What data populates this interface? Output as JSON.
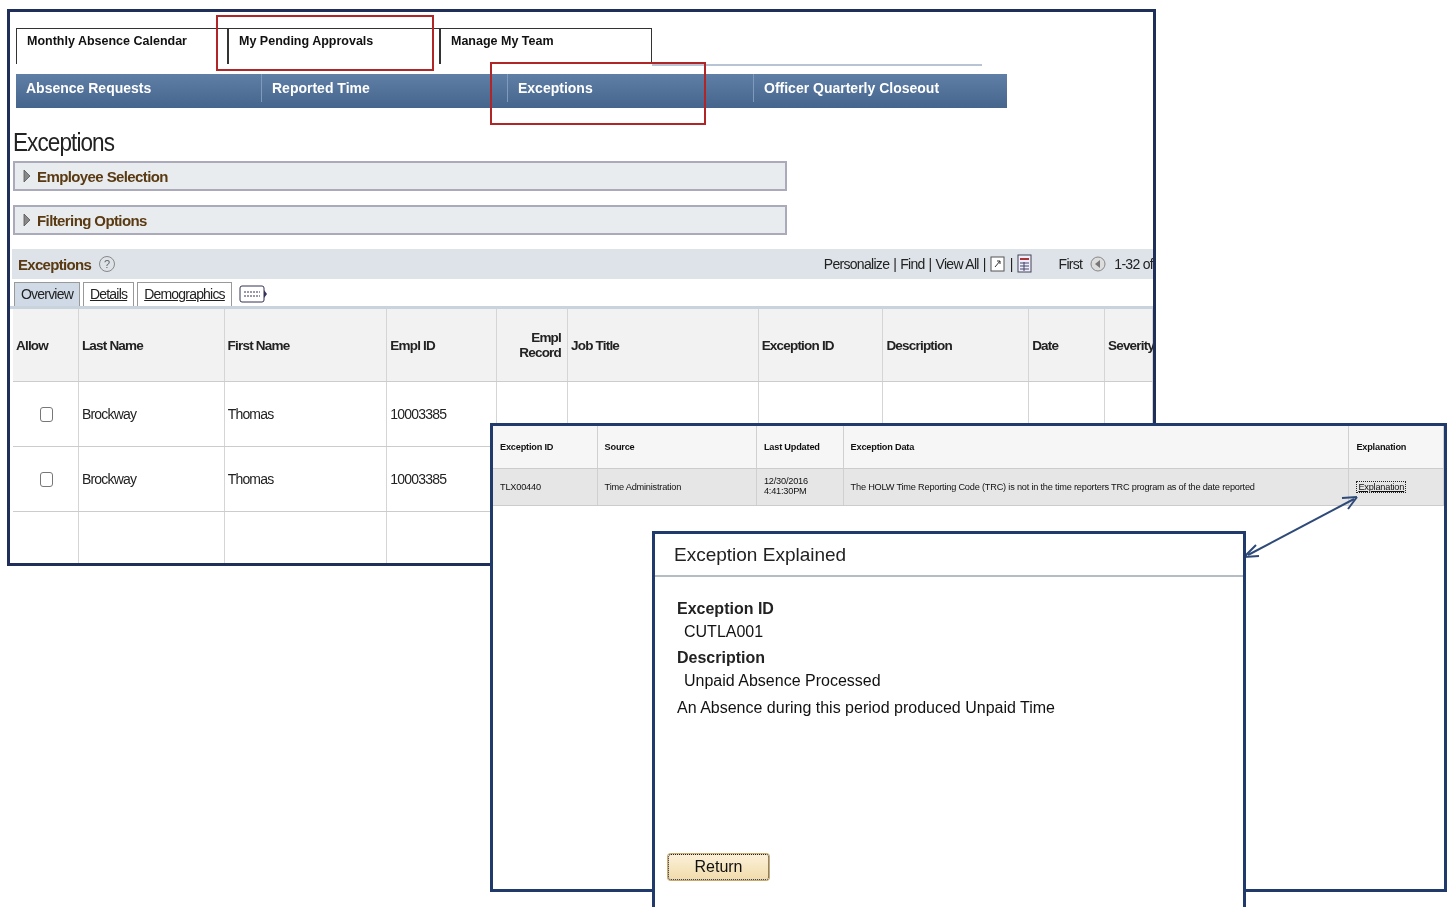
{
  "top_tabs": [
    {
      "label": "Monthly Absence Calendar",
      "highlighted": false
    },
    {
      "label": "My Pending Approvals",
      "highlighted": true
    },
    {
      "label": "Manage My Team",
      "highlighted": false
    }
  ],
  "nav_items": [
    {
      "label": "Absence Requests",
      "highlighted": false
    },
    {
      "label": "Reported Time",
      "highlighted": false
    },
    {
      "label": "Exceptions",
      "highlighted": true
    },
    {
      "label": "Officer Quarterly Closeout",
      "highlighted": false
    }
  ],
  "page_title": "Exceptions",
  "sections": [
    {
      "label": "Employee Selection",
      "expanded": false
    },
    {
      "label": "Filtering Options",
      "expanded": false
    }
  ],
  "grid": {
    "title": "Exceptions",
    "help": "?",
    "toolbar": [
      "Personalize",
      "Find",
      "View All"
    ],
    "separators": [
      "|",
      "|",
      "|",
      "|"
    ],
    "first": "First",
    "range": "1-32 of",
    "tabs": [
      {
        "label": "Overview",
        "selected": true
      },
      {
        "label": "Details",
        "selected": false
      },
      {
        "label": "Demographics",
        "selected": false
      }
    ],
    "columns": [
      "Allow",
      "Last Name",
      "First Name",
      "Empl ID",
      "Empl Record",
      "Job Title",
      "Exception ID",
      "Description",
      "Date",
      "Severity"
    ],
    "rows": [
      {
        "allow": false,
        "last_name": "Brockway",
        "first_name": "Thomas",
        "empl_id": "10003385"
      },
      {
        "allow": false,
        "last_name": "Brockway",
        "first_name": "Thomas",
        "empl_id": "10003385"
      }
    ]
  },
  "detail": {
    "columns": [
      "Exception ID",
      "Source",
      "Last Updated",
      "Exception Data",
      "Explanation"
    ],
    "row": {
      "exception_id": "TLX00440",
      "source": "Time Administration",
      "last_updated": "12/30/2016 4:41:30PM",
      "exception_data": "The HOLW Time Reporting Code (TRC) is not in the time reporters TRC program as of the date reported",
      "explanation": "Explanation"
    }
  },
  "dialog": {
    "title": "Exception Explained",
    "fields": [
      {
        "label": "Exception ID",
        "value": "CUTLA001"
      },
      {
        "label": "Description",
        "value": "Unpaid Absence Processed"
      }
    ],
    "note": "An Absence during this period produced Unpaid Time",
    "button": "Return"
  }
}
